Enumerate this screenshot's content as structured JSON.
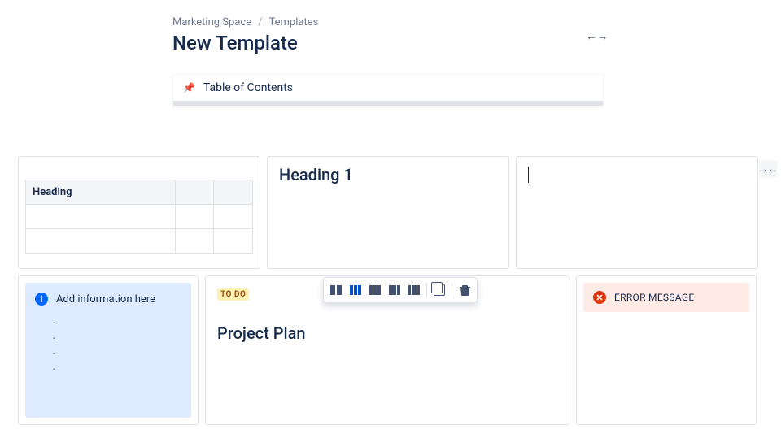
{
  "breadcrumb": {
    "space": "Marketing Space",
    "section": "Templates"
  },
  "page": {
    "title": "New Template"
  },
  "toc": {
    "label": "Table of Contents"
  },
  "row1": {
    "table": {
      "heading": "Heading"
    },
    "heading1": "Heading 1"
  },
  "row2": {
    "info": {
      "text": "Add information here",
      "bullets": [
        "-",
        "-",
        "-",
        "-"
      ]
    },
    "project": {
      "status": "TO DO",
      "title": "Project Plan"
    },
    "error": {
      "text": "ERROR MESSAGE"
    }
  }
}
